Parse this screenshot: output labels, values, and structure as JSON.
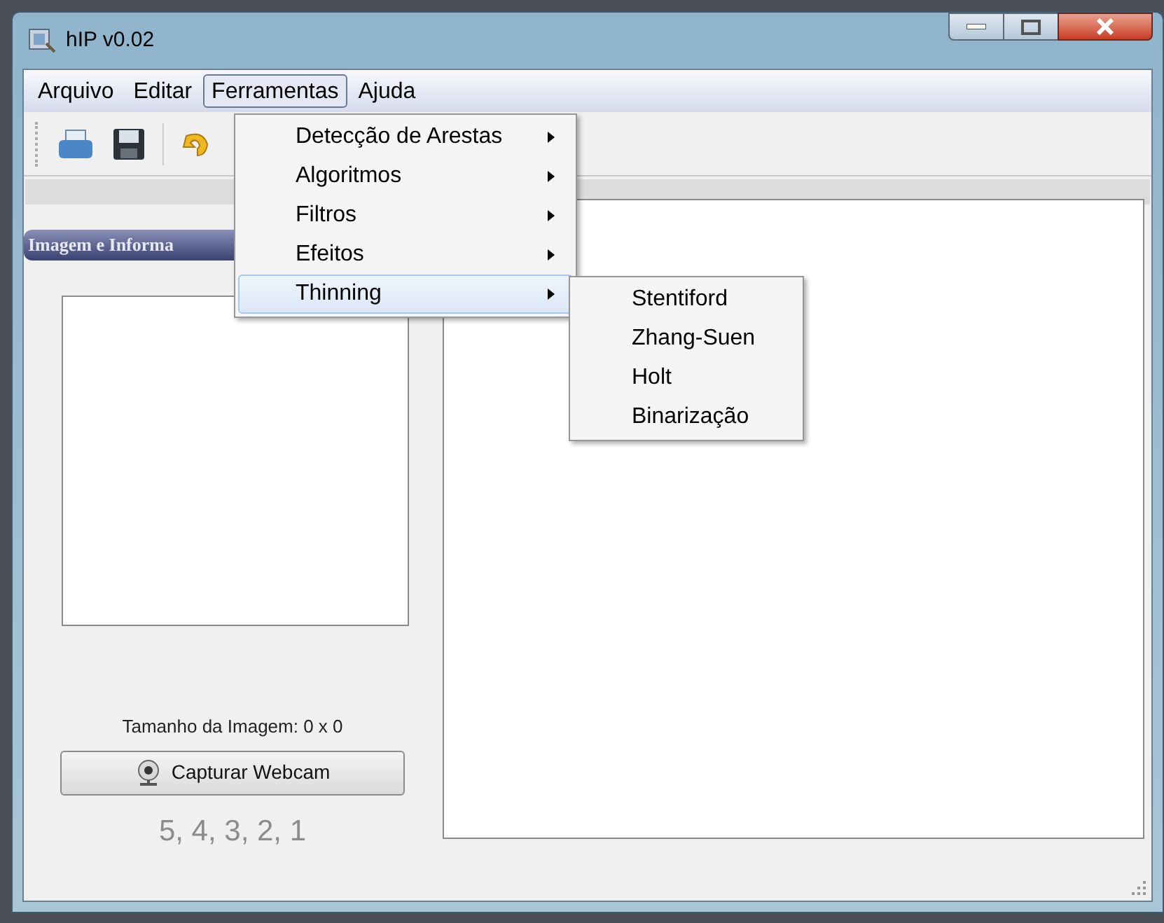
{
  "window": {
    "title": "hIP v0.02"
  },
  "menubar": [
    {
      "label": "Arquivo",
      "selected": false
    },
    {
      "label": "Editar",
      "selected": false
    },
    {
      "label": "Ferramentas",
      "selected": true
    },
    {
      "label": "Ajuda",
      "selected": false
    }
  ],
  "menu": [
    {
      "label": "Detecção de Arestas",
      "selected": false,
      "submenu": true
    },
    {
      "label": "Algoritmos",
      "selected": false,
      "submenu": true
    },
    {
      "label": "Filtros",
      "selected": false,
      "submenu": true
    },
    {
      "label": "Efeitos",
      "selected": false,
      "submenu": true
    },
    {
      "label": "Thinning",
      "selected": true,
      "submenu": true
    }
  ],
  "submenu": [
    {
      "label": "Stentiford"
    },
    {
      "label": "Zhang-Suen"
    },
    {
      "label": "Holt"
    },
    {
      "label": "Binarização"
    }
  ],
  "panel": {
    "title": "Imagem e Informa",
    "size_label": "Tamanho da Imagem: 0 x 0",
    "webcam_button": "Capturar Webcam",
    "countdown": "5, 4, 3, 2, 1"
  }
}
